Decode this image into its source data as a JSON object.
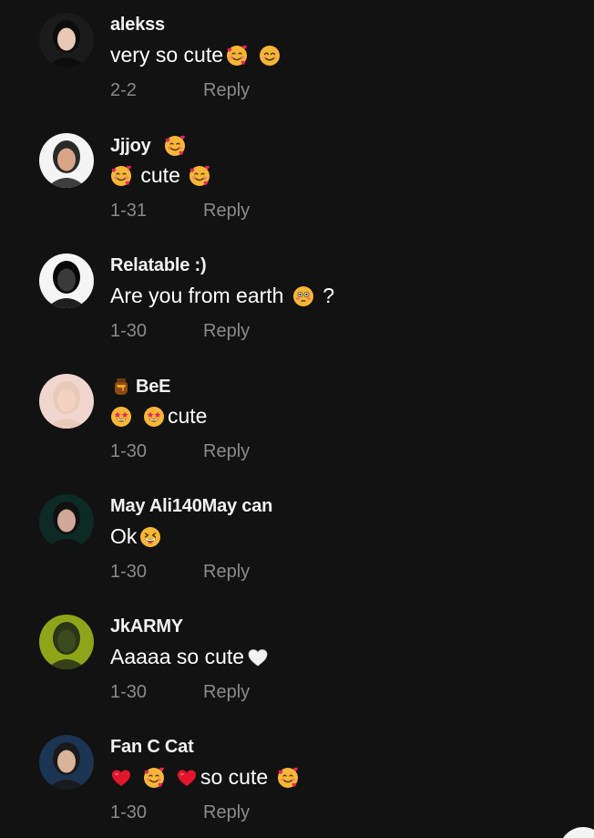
{
  "comments": [
    {
      "username": "alekss",
      "name_emoji": [],
      "text": [
        {
          "t": "text",
          "v": "very so cute"
        },
        {
          "t": "emoji",
          "v": "smiling-face-with-hearts"
        },
        {
          "t": "space"
        },
        {
          "t": "emoji",
          "v": "smiling-face-with-smiling-eyes"
        }
      ],
      "date": "2-2",
      "reply": "Reply",
      "avatar": {
        "bg": "#1b1b1b",
        "skin": "#e8c8b6",
        "hair": "#0c0c0c"
      }
    },
    {
      "username": "Jjjoy",
      "name_emoji": [
        "smiling-face-with-hearts"
      ],
      "text": [
        {
          "t": "emoji",
          "v": "smiling-face-with-hearts"
        },
        {
          "t": "text",
          "v": " cute "
        },
        {
          "t": "emoji",
          "v": "smiling-face-with-hearts"
        }
      ],
      "date": "1-31",
      "reply": "Reply",
      "avatar": {
        "bg": "#f4f4f4",
        "skin": "#d6a588",
        "hair": "#2a2a2a"
      }
    },
    {
      "username": "Relatable :)",
      "name_emoji": [],
      "text": [
        {
          "t": "text",
          "v": "Are you from earth "
        },
        {
          "t": "emoji",
          "v": "flushed-face"
        },
        {
          "t": "text",
          "v": " ?"
        }
      ],
      "date": "1-30",
      "reply": "Reply",
      "avatar": {
        "bg": "#f5f5f5",
        "skin": "#3a3a3a",
        "hair": "#080808"
      }
    },
    {
      "username": "BeE",
      "name_emoji": [
        "honey-pot"
      ],
      "name_emoji_first": true,
      "text": [
        {
          "t": "emoji",
          "v": "star-struck"
        },
        {
          "t": "space"
        },
        {
          "t": "emoji",
          "v": "star-struck"
        },
        {
          "t": "text",
          "v": "cute"
        }
      ],
      "date": "1-30",
      "reply": "Reply",
      "avatar": {
        "bg": "#f1d6d0",
        "skin": "#f3d2c2",
        "hair": "#e9c9b8"
      }
    },
    {
      "username": "May Ali140May can",
      "name_emoji": [],
      "text": [
        {
          "t": "text",
          "v": "Ok"
        },
        {
          "t": "emoji",
          "v": "grinning-squinting-face"
        }
      ],
      "date": "1-30",
      "reply": "Reply",
      "avatar": {
        "bg": "#0d2a24",
        "skin": "#cfa89a",
        "hair": "#111111"
      }
    },
    {
      "username": "JkARMY",
      "name_emoji": [],
      "text": [
        {
          "t": "text",
          "v": "Aaaaa so cute"
        },
        {
          "t": "emoji",
          "v": "white-heart"
        }
      ],
      "date": "1-30",
      "reply": "Reply",
      "avatar": {
        "bg": "#8ea51a",
        "skin": "#3c4a20",
        "hair": "#2b3518"
      }
    },
    {
      "username": "Fan C Cat",
      "name_emoji": [],
      "text": [
        {
          "t": "emoji",
          "v": "red-heart"
        },
        {
          "t": "space"
        },
        {
          "t": "emoji",
          "v": "smiling-face-with-hearts"
        },
        {
          "t": "space"
        },
        {
          "t": "emoji",
          "v": "red-heart"
        },
        {
          "t": "text",
          "v": "so cute "
        },
        {
          "t": "emoji",
          "v": "smiling-face-with-hearts"
        }
      ],
      "date": "1-30",
      "reply": "Reply",
      "avatar": {
        "bg": "#1c3553",
        "skin": "#d9b39a",
        "hair": "#1a1a1a"
      }
    }
  ],
  "colors": {
    "background": "#121212",
    "username": "#f2f2f2",
    "text": "#ffffff",
    "meta": "#8a8a8a"
  }
}
